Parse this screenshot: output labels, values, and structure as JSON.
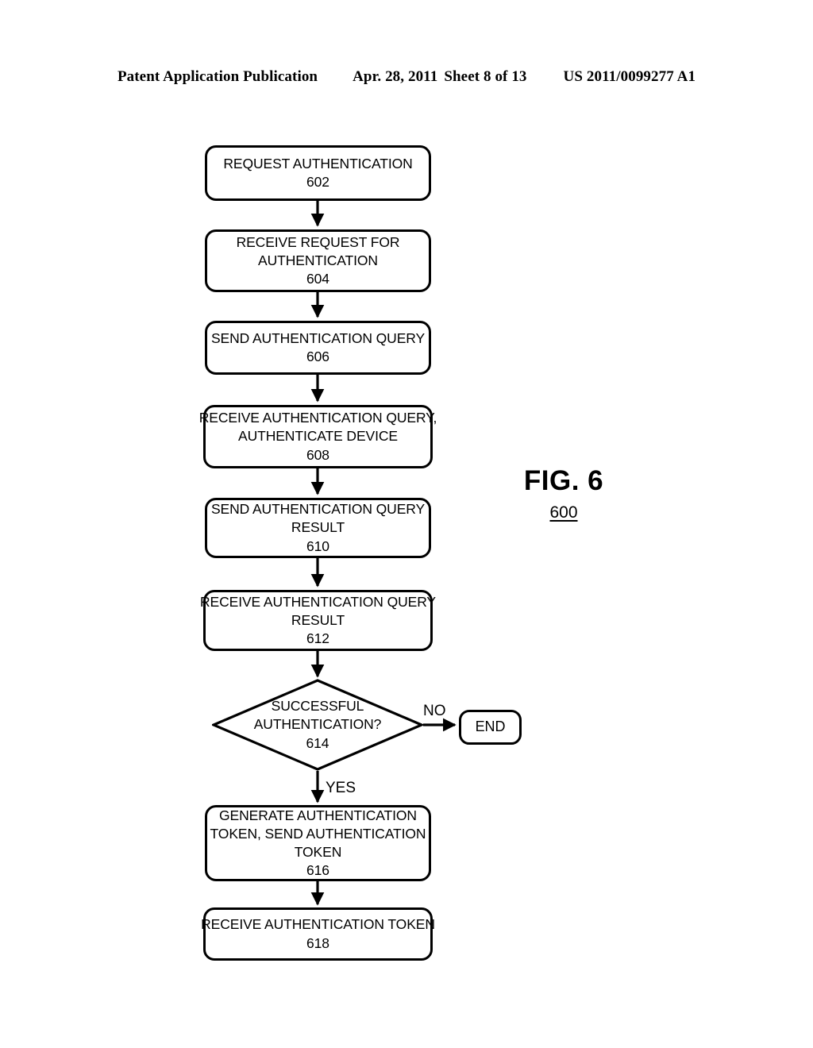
{
  "header": {
    "publication": "Patent Application Publication",
    "date": "Apr. 28, 2011",
    "sheet": "Sheet 8 of 13",
    "number": "US 2011/0099277 A1"
  },
  "figure": {
    "title": "FIG. 6",
    "number": "600"
  },
  "flowchart": {
    "nodes": [
      {
        "id": "602",
        "shape": "process",
        "lines": [
          "REQUEST AUTHENTICATION"
        ],
        "ref": "602"
      },
      {
        "id": "604",
        "shape": "process",
        "lines": [
          "RECEIVE REQUEST FOR",
          "AUTHENTICATION"
        ],
        "ref": "604"
      },
      {
        "id": "606",
        "shape": "process",
        "lines": [
          "SEND AUTHENTICATION QUERY"
        ],
        "ref": "606"
      },
      {
        "id": "608",
        "shape": "process",
        "lines": [
          "RECEIVE AUTHENTICATION QUERY,",
          "AUTHENTICATE DEVICE"
        ],
        "ref": "608"
      },
      {
        "id": "610",
        "shape": "process",
        "lines": [
          "SEND AUTHENTICATION QUERY",
          "RESULT"
        ],
        "ref": "610"
      },
      {
        "id": "612",
        "shape": "process",
        "lines": [
          "RECEIVE AUTHENTICATION QUERY",
          "RESULT"
        ],
        "ref": "612"
      },
      {
        "id": "614",
        "shape": "decision",
        "lines": [
          "SUCCESSFUL",
          "AUTHENTICATION?"
        ],
        "ref": "614"
      },
      {
        "id": "616",
        "shape": "process",
        "lines": [
          "GENERATE AUTHENTICATION",
          "TOKEN, SEND AUTHENTICATION",
          "TOKEN"
        ],
        "ref": "616"
      },
      {
        "id": "618",
        "shape": "process",
        "lines": [
          "RECEIVE AUTHENTICATION TOKEN"
        ],
        "ref": "618"
      },
      {
        "id": "end",
        "shape": "terminator",
        "lines": [
          "END"
        ],
        "ref": ""
      }
    ],
    "edge_labels": {
      "no": "NO",
      "yes": "YES"
    }
  },
  "style": {
    "stroke": "#000000",
    "background": "#ffffff"
  }
}
